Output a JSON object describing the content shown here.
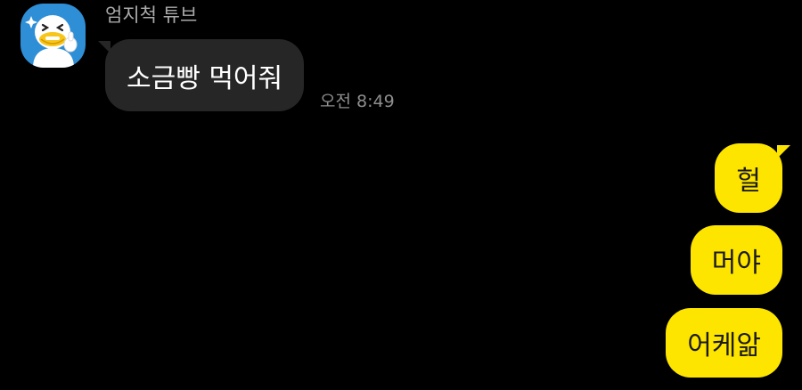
{
  "colors": {
    "background": "#000000",
    "incoming_bubble": "#262626",
    "outgoing_bubble": "#fee500",
    "sender_name": "#a9a9a9",
    "timestamp": "#8e8e8e",
    "avatar_background": "#2f8fd6"
  },
  "incoming": {
    "avatar_icon": "duck-character-avatar-icon",
    "sender_name": "엄지척 튜브",
    "message": "소금빵 먹어줘",
    "time": "오전 8:49"
  },
  "outgoing": [
    {
      "text": "헐"
    },
    {
      "text": "머야"
    },
    {
      "text": "어케앎"
    }
  ]
}
